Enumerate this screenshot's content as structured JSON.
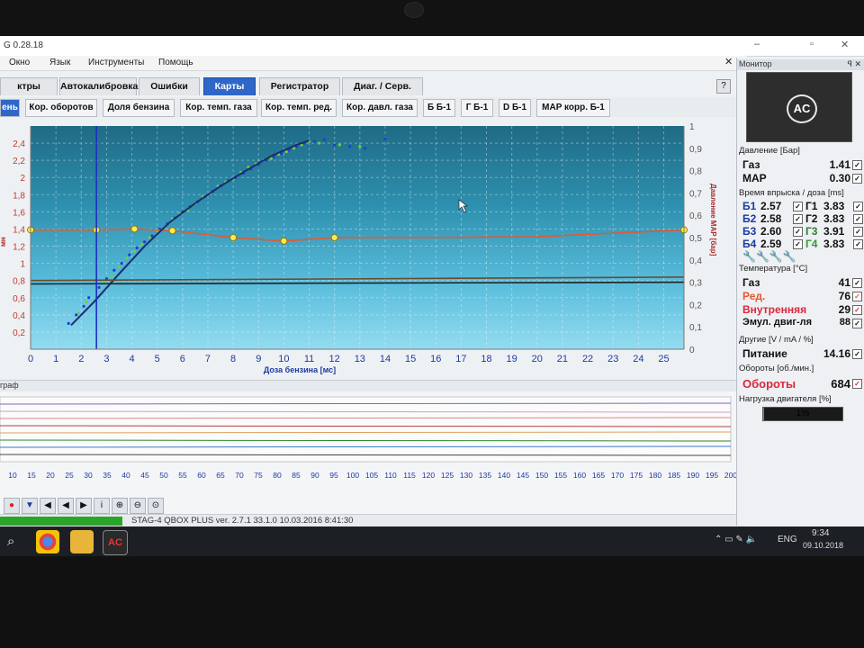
{
  "window": {
    "title": "G 0.28.18",
    "minimize": "–",
    "maximize": "▫",
    "close": "✕"
  },
  "menu": [
    "Окно",
    "Язык",
    "Инструменты",
    "Помощь"
  ],
  "tabs": [
    {
      "label": "ктры",
      "active": false
    },
    {
      "label": "Автокалибровка",
      "active": false
    },
    {
      "label": "Ошибки",
      "active": false
    },
    {
      "label": "Карты",
      "active": true
    },
    {
      "label": "Регистратор",
      "active": false
    },
    {
      "label": "Диаг. / Серв.",
      "active": false
    }
  ],
  "subtabs": [
    {
      "label": "ень",
      "active": true
    },
    {
      "label": "Кор. оборотов",
      "active": false
    },
    {
      "label": "Доля бензина",
      "active": false
    },
    {
      "label": "Кор. темп. газа",
      "active": false
    },
    {
      "label": "Кор. темп. ред.",
      "active": false
    },
    {
      "label": "Кор. давл. газа",
      "active": false
    },
    {
      "label": "Б Б-1",
      "active": false
    },
    {
      "label": "Г Б-1",
      "active": false
    },
    {
      "label": "D Б-1",
      "active": false
    },
    {
      "label": "MAP корр. Б-1",
      "active": false
    }
  ],
  "chart_data": {
    "type": "scatter",
    "xlabel": "Доза бензина [мс]",
    "ylabel_left": "мн",
    "ylabel_right": "Давление MAP [бар]",
    "xlim": [
      0,
      25.8
    ],
    "ylim": [
      0,
      2.6
    ],
    "ylim_right": [
      0,
      1.0
    ],
    "x_ticks": [
      0,
      1,
      2,
      3,
      4,
      5,
      6,
      7,
      8,
      9,
      10,
      11,
      12,
      13,
      14,
      15,
      16,
      17,
      18,
      19,
      20,
      21,
      22,
      23,
      24,
      25
    ],
    "y_ticks": [
      0.2,
      0.4,
      0.6,
      0.8,
      1.0,
      1.2,
      1.4,
      1.6,
      1.8,
      2.0,
      2.2,
      2.4
    ],
    "y_ticks_labels": [
      "0,2",
      "0,4",
      "0,6",
      "0,8",
      "1",
      "1,2",
      "1,4",
      "1,6",
      "1,8",
      "2",
      "2,2",
      "2,4"
    ],
    "y_right_ticks": [
      0,
      0.1,
      0.2,
      0.3,
      0.4,
      0.5,
      0.6,
      0.7,
      0.8,
      0.9,
      1
    ],
    "y_right_ticks_labels": [
      "0",
      "0,1",
      "0,2",
      "0,3",
      "0,4",
      "0,5",
      "0,6",
      "0,7",
      "0,8",
      "0,9",
      "1"
    ],
    "grid": true,
    "vertical_marker_x": 2.6,
    "series": [
      {
        "name": "",
        "kind": "line",
        "color": "#e8572d",
        "x": [
          0,
          2.6,
          4.1,
          5.6,
          8,
          10,
          12,
          15,
          20,
          25.8
        ],
        "y": [
          1.39,
          1.39,
          1.4,
          1.38,
          1.3,
          1.26,
          1.3,
          1.3,
          1.31,
          1.39
        ],
        "markers_x": [
          0,
          2.6,
          4.1,
          5.6,
          8,
          10,
          12,
          25.8
        ],
        "markers_y": [
          1.39,
          1.39,
          1.4,
          1.38,
          1.3,
          1.26,
          1.3,
          1.39
        ]
      },
      {
        "name": "",
        "kind": "line",
        "color": "#1c2b6e",
        "x": [
          1.6,
          2.5,
          3.5,
          4.5,
          5.5,
          6.5,
          7.5,
          8.5,
          9.5,
          10.5,
          11
        ],
        "y": [
          0.28,
          0.55,
          0.88,
          1.2,
          1.48,
          1.7,
          1.9,
          2.08,
          2.25,
          2.38,
          2.43
        ]
      },
      {
        "name": "",
        "kind": "line",
        "color": "#222222",
        "x": [
          0,
          25.8
        ],
        "y": [
          0.76,
          0.78
        ]
      },
      {
        "name": "",
        "kind": "line",
        "color": "#6a4a2a",
        "x": [
          0,
          25.8
        ],
        "y": [
          0.8,
          0.84
        ]
      }
    ],
    "scatter_blue": {
      "color": "#1f3ed6",
      "x": [
        1.5,
        1.8,
        2.1,
        2.3,
        2.7,
        3.0,
        3.3,
        3.6,
        3.9,
        4.2,
        4.5,
        4.8,
        5.1,
        5.4,
        5.7,
        6.0,
        6.3,
        6.6,
        6.9,
        7.2,
        7.5,
        7.8,
        8.1,
        8.4,
        8.7,
        9.0,
        9.3,
        9.6,
        9.9,
        10.2,
        10.5,
        10.8,
        11.2,
        11.6,
        12.0,
        12.6,
        13.2,
        14.0
      ],
      "y": [
        0.3,
        0.4,
        0.5,
        0.6,
        0.72,
        0.82,
        0.92,
        1.0,
        1.1,
        1.18,
        1.25,
        1.32,
        1.4,
        1.46,
        1.53,
        1.6,
        1.66,
        1.72,
        1.78,
        1.84,
        1.9,
        1.96,
        2.0,
        2.05,
        2.1,
        2.15,
        2.2,
        2.24,
        2.28,
        2.32,
        2.36,
        2.4,
        2.42,
        2.44,
        2.38,
        2.36,
        2.34,
        2.45
      ]
    },
    "scatter_green": {
      "color": "#6fd13c",
      "x": [
        1.9,
        2.2,
        2.6,
        2.9,
        3.2,
        3.5,
        3.8,
        4.1,
        4.4,
        4.7,
        5.0,
        5.3,
        5.6,
        5.9,
        6.2,
        6.5,
        6.8,
        7.1,
        7.4,
        7.7,
        8.0,
        8.3,
        8.6,
        8.9,
        9.2,
        9.5,
        9.8,
        10.1,
        10.4,
        10.7,
        11.0,
        11.4,
        12.2,
        13.0
      ],
      "y": [
        0.42,
        0.55,
        0.7,
        0.78,
        0.85,
        0.96,
        1.06,
        1.14,
        1.22,
        1.3,
        1.38,
        1.42,
        1.52,
        1.58,
        1.62,
        1.7,
        1.78,
        1.82,
        1.9,
        1.95,
        1.98,
        2.06,
        2.12,
        2.16,
        2.2,
        2.22,
        2.27,
        2.3,
        2.34,
        2.38,
        2.42,
        2.4,
        2.38,
        2.36
      ]
    }
  },
  "lower": {
    "title": "граф",
    "x_ticks": [
      "10",
      "15",
      "20",
      "25",
      "30",
      "35",
      "40",
      "45",
      "50",
      "55",
      "60",
      "65",
      "70",
      "75",
      "80",
      "85",
      "90",
      "95",
      "100",
      "105",
      "110",
      "115",
      "120",
      "125",
      "130",
      "135",
      "140",
      "145",
      "150",
      "155",
      "160",
      "165",
      "170",
      "175",
      "180",
      "185",
      "190",
      "195",
      "200"
    ]
  },
  "status": {
    "text": "STAG-4 QBOX PLUS  ver. 2.7.1  33.1.0  10.03.2016 8:41:30",
    "progress": 1.0
  },
  "monitor": {
    "title": "Монитор",
    "logo": "AC",
    "pressure": {
      "title": "Давление [Бар]",
      "rows": [
        {
          "label": "Газ",
          "value": "1.41"
        },
        {
          "label": "MAP",
          "value": "0.30"
        }
      ]
    },
    "injection": {
      "title": "Время впрыска / доза [ms]",
      "rows": [
        {
          "b": "Б1",
          "bv": "2.57",
          "g": "Г1",
          "gv": "3.83",
          "gcolor": "#111111"
        },
        {
          "b": "Б2",
          "bv": "2.58",
          "g": "Г2",
          "gv": "3.83",
          "gcolor": "#111111"
        },
        {
          "b": "Б3",
          "bv": "2.60",
          "g": "Г3",
          "gv": "3.91",
          "gcolor": "#2e7d2e"
        },
        {
          "b": "Б4",
          "bv": "2.59",
          "g": "Г4",
          "gv": "3.83",
          "gcolor": "#2e9d2e"
        }
      ]
    },
    "temperature": {
      "title": "Температура [°C]",
      "rows": [
        {
          "label": "Газ",
          "value": "41",
          "color": "#111111"
        },
        {
          "label": "Ред.",
          "value": "76",
          "color": "#e8572d"
        },
        {
          "label": "Внутренняя",
          "value": "29",
          "color": "#d8283c"
        },
        {
          "label": "Эмул. двиг-ля",
          "value": "88",
          "color": "#111111"
        }
      ]
    },
    "other": {
      "title": "Другие [V / mA / %]",
      "rows": [
        {
          "label": "Питание",
          "value": "14.16"
        }
      ]
    },
    "rpm": {
      "title": "Обороты [об./мин.]",
      "label": "Обороты",
      "value": "684"
    },
    "load": {
      "title": "Нагрузка двигателя [%]",
      "value": "1%",
      "fraction": 0.01
    }
  },
  "taskbar": {
    "lang": "ENG",
    "time": "9:34",
    "date": "09.10.2018"
  }
}
